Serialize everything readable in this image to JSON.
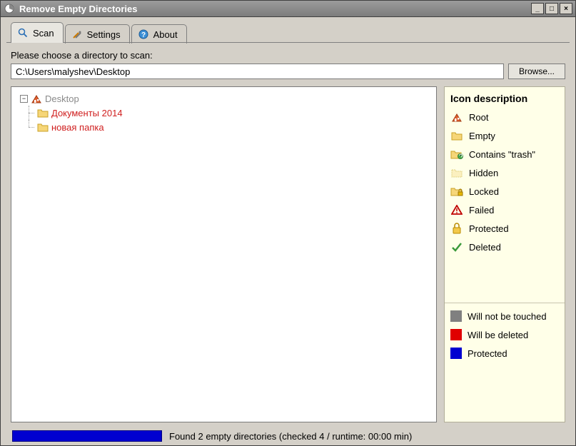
{
  "window": {
    "title": "Remove Empty Directories"
  },
  "tabs": [
    {
      "id": "scan",
      "label": "Scan",
      "icon": "search-icon",
      "active": true
    },
    {
      "id": "settings",
      "label": "Settings",
      "icon": "tools-icon",
      "active": false
    },
    {
      "id": "about",
      "label": "About",
      "icon": "help-icon",
      "active": false
    }
  ],
  "prompt": "Please choose a directory to scan:",
  "path_value": "C:\\Users\\malyshev\\Desktop",
  "browse_label": "Browse...",
  "tree": {
    "root": {
      "label": "Desktop",
      "icon": "root-icon",
      "expanded": true,
      "style": "muted"
    },
    "children": [
      {
        "label": "Документы 2014",
        "icon": "folder-icon",
        "style": "danger"
      },
      {
        "label": "новая папка",
        "icon": "folder-icon",
        "style": "danger"
      }
    ]
  },
  "legend": {
    "title": "Icon description",
    "items": [
      {
        "icon": "root-icon",
        "label": "Root"
      },
      {
        "icon": "folder-icon",
        "label": "Empty"
      },
      {
        "icon": "folder-trash-icon",
        "label": "Contains \"trash\""
      },
      {
        "icon": "folder-hidden-icon",
        "label": "Hidden"
      },
      {
        "icon": "folder-locked-icon",
        "label": "Locked"
      },
      {
        "icon": "failed-icon",
        "label": "Failed"
      },
      {
        "icon": "protected-icon",
        "label": "Protected"
      },
      {
        "icon": "deleted-icon",
        "label": "Deleted"
      }
    ],
    "color_legend": [
      {
        "color": "#808080",
        "label": "Will not be touched"
      },
      {
        "color": "#e00000",
        "label": "Will be deleted"
      },
      {
        "color": "#0000d0",
        "label": "Protected"
      }
    ]
  },
  "status_text": "Found 2 empty directories (checked 4 / runtime: 00:00 min)"
}
